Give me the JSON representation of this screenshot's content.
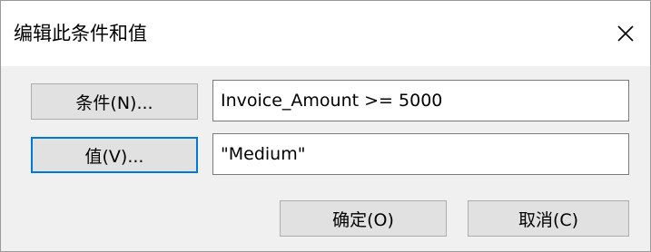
{
  "dialog": {
    "title": "编辑此条件和值",
    "close_icon": "close-x-icon"
  },
  "buttons": {
    "condition_label": "条件(N)...",
    "value_label": "值(V)...",
    "ok_label": "确定(O)",
    "cancel_label": "取消(C)"
  },
  "fields": {
    "condition_value": "Invoice_Amount >= 5000",
    "value_value": "\"Medium\""
  },
  "colors": {
    "dialog_background": "#f0f0f0",
    "titlebar_background": "#ffffff",
    "button_background": "#e1e1e1",
    "focus_border": "#0078d7"
  }
}
